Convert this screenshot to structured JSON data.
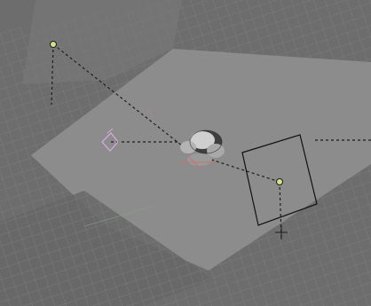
{
  "viewport": {
    "background": "#6f6f6f",
    "objects": [
      {
        "name": "camera-object",
        "icon": "camera-icon"
      },
      {
        "name": "lamp-object",
        "icon": "lamp-icon"
      },
      {
        "name": "mesh-object",
        "icon": "mesh-icon"
      },
      {
        "name": "selected-plane-object",
        "icon": "plane-icon"
      },
      {
        "name": "lamp-object-2",
        "icon": "lamp-icon"
      }
    ]
  }
}
